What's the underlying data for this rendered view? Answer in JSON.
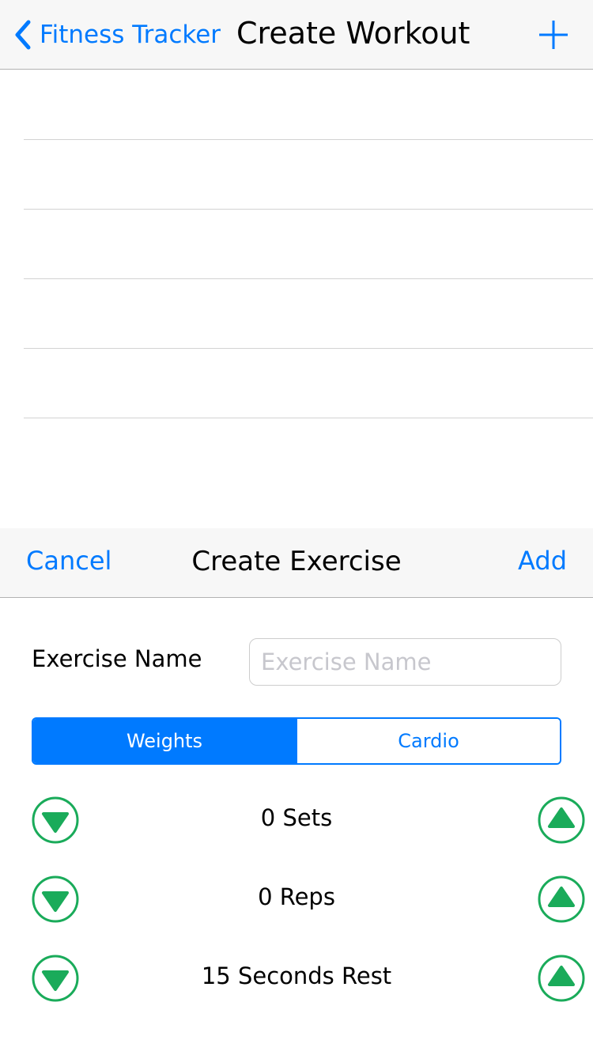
{
  "navbar": {
    "back_label": "Fitness Tracker",
    "title": "Create Workout",
    "add_icon": "plus-icon"
  },
  "table": {
    "row_count": 6
  },
  "sheet": {
    "cancel_label": "Cancel",
    "title": "Create Exercise",
    "add_label": "Add",
    "exercise_name_label": "Exercise Name",
    "exercise_name_value": "",
    "exercise_name_placeholder": "Exercise Name",
    "segments": [
      {
        "label": "Weights",
        "selected": true
      },
      {
        "label": "Cardio",
        "selected": false
      }
    ],
    "steppers": [
      {
        "label": "0 Sets",
        "down_icon": "chevron-down-circle-icon",
        "up_icon": "chevron-up-circle-icon"
      },
      {
        "label": "0 Reps",
        "down_icon": "chevron-down-circle-icon",
        "up_icon": "chevron-up-circle-icon"
      },
      {
        "label": "15 Seconds Rest",
        "down_icon": "chevron-down-circle-icon",
        "up_icon": "chevron-up-circle-icon"
      }
    ]
  },
  "colors": {
    "accent": "#007aff",
    "stepper_green": "#1aab5a",
    "bar_background": "#f7f7f7",
    "separator": "#d2d2d2"
  }
}
